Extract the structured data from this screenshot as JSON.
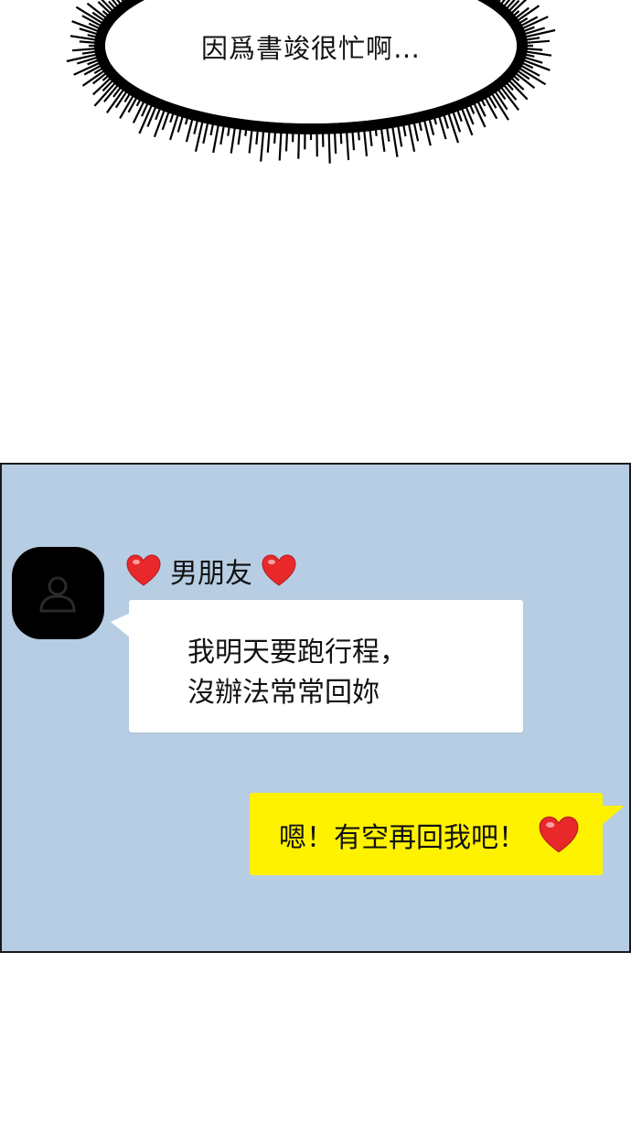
{
  "thought_bubble": {
    "text": "因爲書竣很忙啊…"
  },
  "chat": {
    "sender": {
      "name": "男朋友",
      "heart_icon": "red-heart-icon",
      "avatar_icon": "person-icon"
    },
    "incoming": {
      "line1": "我明天要跑行程，",
      "line2": "沒辦法常常回妳"
    },
    "outgoing": {
      "text": "嗯！有空再回我吧！",
      "heart_icon": "red-heart-icon"
    }
  },
  "colors": {
    "chat_background": "#b6cde3",
    "incoming_bubble": "#ffffff",
    "outgoing_bubble": "#fff200",
    "heart": "#e8282b",
    "avatar": "#000000"
  }
}
